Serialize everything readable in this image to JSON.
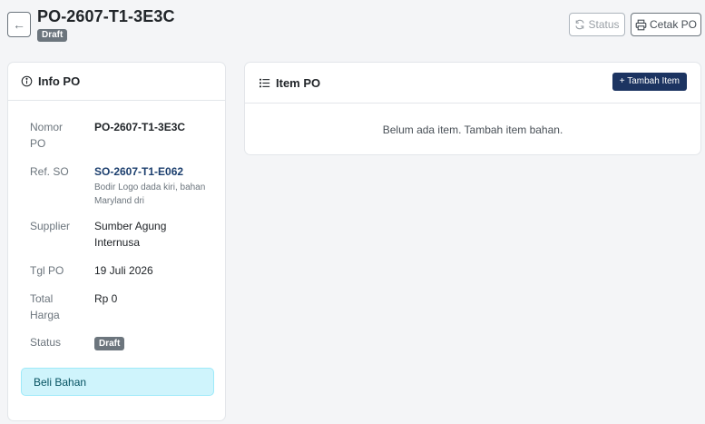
{
  "header": {
    "back_label": "←",
    "title": "PO-2607-T1-3E3C",
    "badge": "Draft",
    "status_button": "Status",
    "print_button": "Cetak PO"
  },
  "info_card": {
    "title": "Info PO",
    "rows": [
      {
        "label": "Nomor PO",
        "value": "PO-2607-T1-3E3C"
      },
      {
        "label": "Ref. SO",
        "value": "SO-2607-T1-E062",
        "note": "Bodir Logo dada kiri, bahan Maryland dri"
      },
      {
        "label": "Supplier",
        "value": "Sumber Agung Internusa"
      },
      {
        "label": "Tgl PO",
        "value": "19 Juli 2026"
      },
      {
        "label": "Total Harga",
        "value": "Rp 0"
      },
      {
        "label": "Status",
        "value": "Draft"
      }
    ],
    "alert": "Beli Bahan"
  },
  "items_card": {
    "title": "Item PO",
    "add_button": "+ Tambah Item",
    "empty_message": "Belum ada item. Tambah item bahan."
  },
  "colors": {
    "primary": "#1c3461",
    "badge_gray": "#6c757d",
    "alert_bg": "#cff4fc",
    "link": "#1c3f6e"
  },
  "icons": [
    "arrow-left-icon",
    "refresh-icon",
    "printer-icon",
    "info-icon",
    "list-icon"
  ]
}
